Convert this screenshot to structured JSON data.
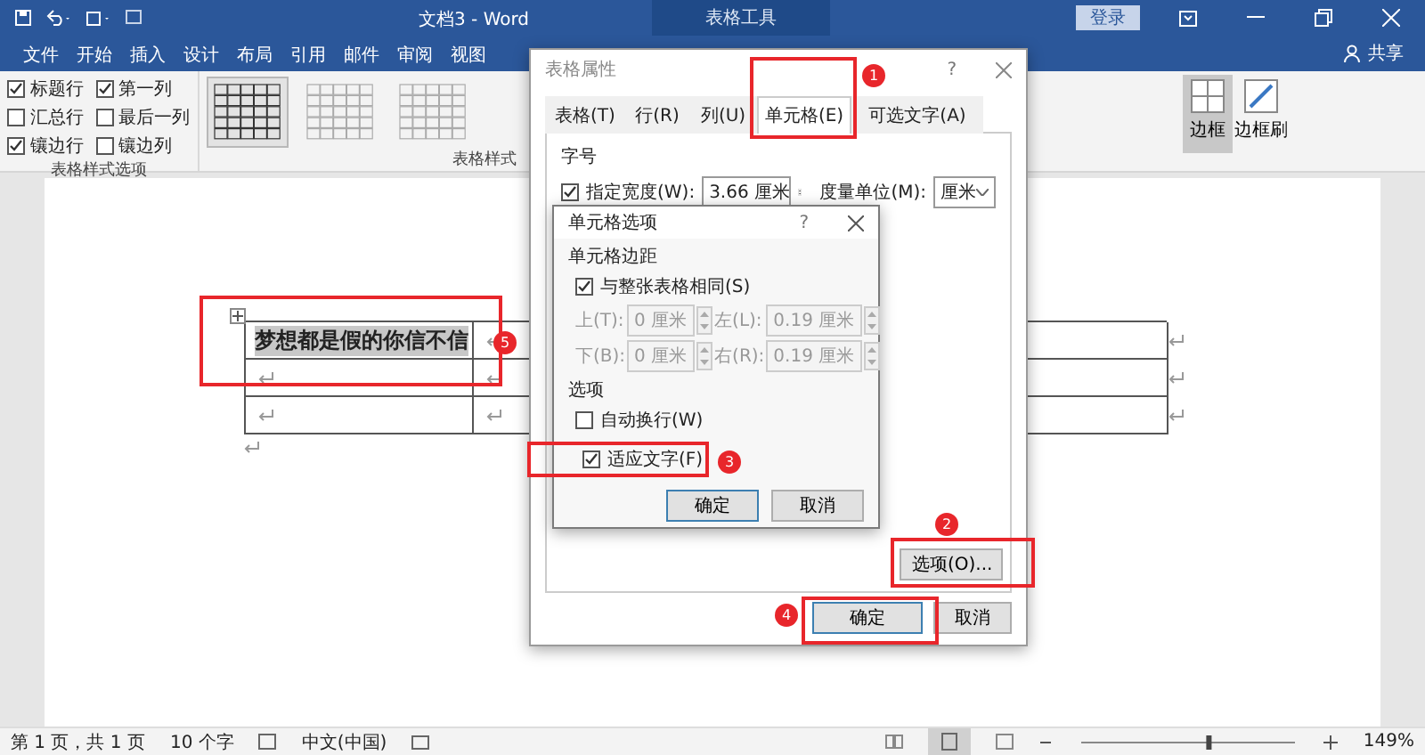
{
  "title_bar": {
    "title": "文档3 - Word",
    "context_tab": "表格工具",
    "sign_in": "登录"
  },
  "ribbon_tabs": [
    {
      "label": "文件",
      "selected": false
    },
    {
      "label": "开始",
      "selected": false
    },
    {
      "label": "插入",
      "selected": false
    },
    {
      "label": "设计",
      "selected": false
    },
    {
      "label": "布局",
      "selected": false
    },
    {
      "label": "引用",
      "selected": false
    },
    {
      "label": "邮件",
      "selected": false
    },
    {
      "label": "审阅",
      "selected": false
    },
    {
      "label": "视图",
      "selected": false
    }
  ],
  "share": "共享",
  "ribbon": {
    "style_options": {
      "label": "表格样式选项",
      "items": [
        {
          "label": "标题行",
          "checked": true
        },
        {
          "label": "第一列",
          "checked": true
        },
        {
          "label": "汇总行",
          "checked": false
        },
        {
          "label": "最后一列",
          "checked": false
        },
        {
          "label": "镶边行",
          "checked": true
        },
        {
          "label": "镶边列",
          "checked": false
        }
      ]
    },
    "table_styles": {
      "label": "表格样式"
    },
    "borders": [
      {
        "label": "边框",
        "selected": true
      },
      {
        "label": "边框刷",
        "selected": false
      }
    ]
  },
  "document": {
    "table": {
      "rows": [
        [
          {
            "text": "梦想都是假的你信不信",
            "selected": true
          },
          {
            "text": ""
          }
        ],
        [
          {
            "text": ""
          },
          {
            "text": ""
          }
        ],
        [
          {
            "text": ""
          },
          {
            "text": ""
          }
        ]
      ]
    }
  },
  "table_properties": {
    "title": "表格属性",
    "help": "?",
    "tabs": [
      {
        "label": "表格(T)",
        "selected": false
      },
      {
        "label": "行(R)",
        "selected": false
      },
      {
        "label": "列(U)",
        "selected": false
      },
      {
        "label": "单元格(E)",
        "selected": true
      },
      {
        "label": "可选文字(A)",
        "selected": false
      }
    ],
    "section": "字号",
    "width_check": {
      "label": "指定宽度(W):",
      "checked": true
    },
    "width_value": "3.66 厘米",
    "unit_label": "度量单位(M):",
    "unit_value": "厘米",
    "options_button": "选项(O)...",
    "ok": "确定",
    "cancel": "取消"
  },
  "cell_options": {
    "title": "单元格选项",
    "help": "?",
    "margins_label": "单元格边距",
    "same_as_table": {
      "label": "与整张表格相同(S)",
      "checked": true
    },
    "margins": [
      {
        "label": "上(T):",
        "value": "0 厘米"
      },
      {
        "label": "左(L):",
        "value": "0.19 厘米"
      },
      {
        "label": "下(B):",
        "value": "0 厘米"
      },
      {
        "label": "右(R):",
        "value": "0.19 厘米"
      }
    ],
    "options_label": "选项",
    "options": [
      {
        "label": "自动换行(W)",
        "checked": false
      },
      {
        "label": "适应文字(F)",
        "checked": true
      }
    ],
    "ok": "确定",
    "cancel": "取消"
  },
  "annotations": [
    {
      "number": "1"
    },
    {
      "number": "2"
    },
    {
      "number": "3"
    },
    {
      "number": "4"
    },
    {
      "number": "5"
    }
  ],
  "status_bar": {
    "page": "第 1 页，共 1 页",
    "words": "10 个字",
    "language": "中文(中国)",
    "zoom": "149%",
    "zoom_slider": {
      "level": 0.6
    }
  }
}
